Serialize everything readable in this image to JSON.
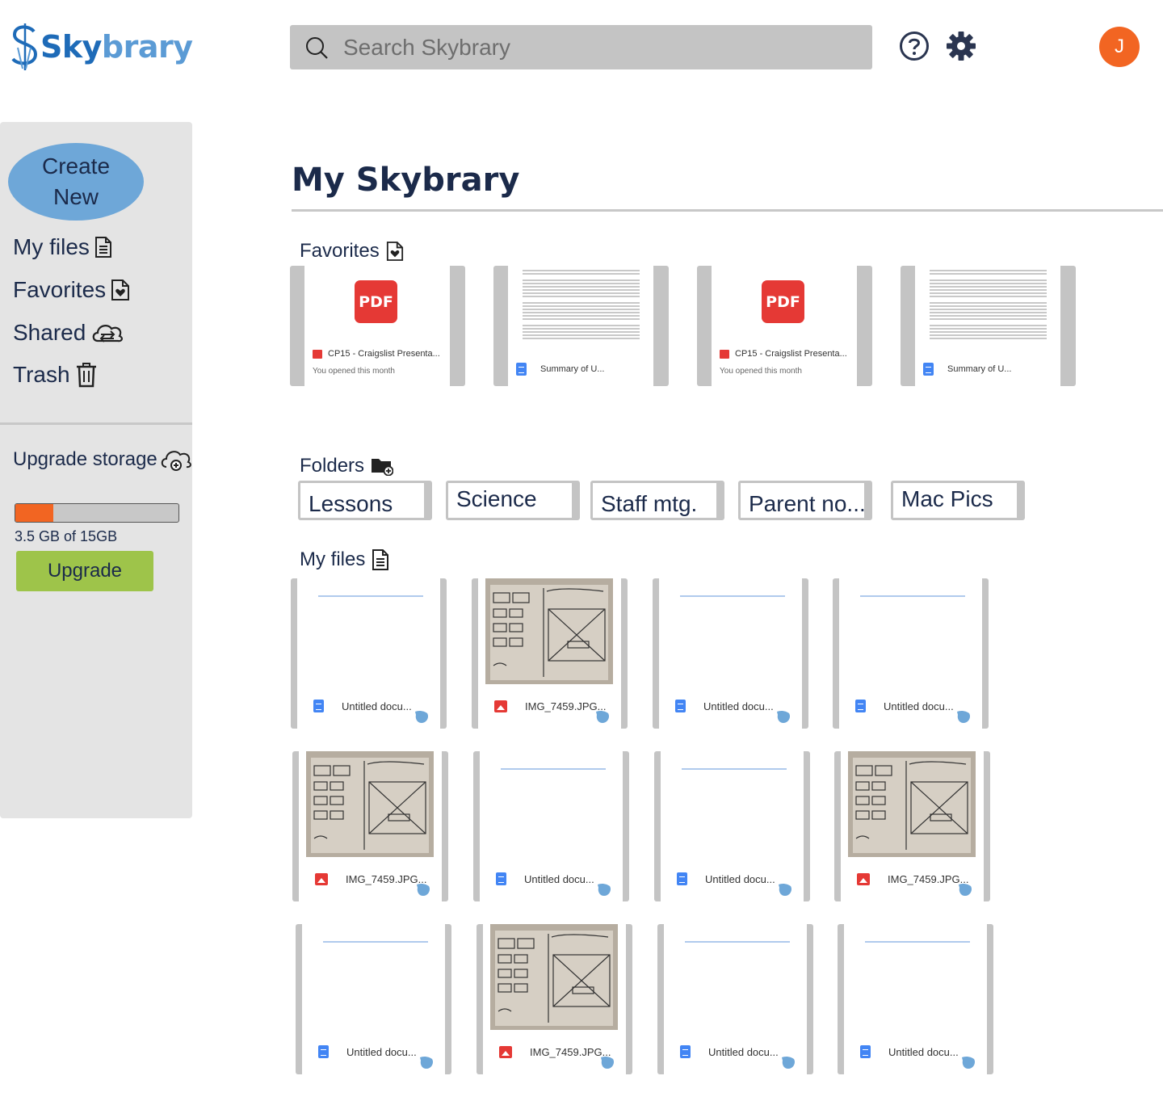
{
  "app": {
    "logo_sky": "Sky",
    "logo_brary": "brary",
    "logo_mark": "$"
  },
  "header": {
    "search_placeholder": "Search Skybrary",
    "avatar_initial": "J",
    "icons": [
      "help-icon",
      "gear-icon"
    ]
  },
  "sidebar": {
    "create_line1": "Create",
    "create_line2": "New",
    "items": [
      {
        "label": "My files",
        "icon": "document-icon"
      },
      {
        "label": "Favorites",
        "icon": "favorite-file-icon"
      },
      {
        "label": "Shared",
        "icon": "cloud-share-icon"
      },
      {
        "label": "Trash",
        "icon": "trash-icon"
      }
    ],
    "upgrade_storage_label": "Upgrade storage",
    "storage_used_fraction": 0.233,
    "storage_text": "3.5 GB of 15GB",
    "upgrade_button": "Upgrade",
    "colors": {
      "storage_fill": "#f26522",
      "upgrade_button": "#9ec44a",
      "create_button": "#6ea7d8"
    }
  },
  "main": {
    "title": "My Skybrary",
    "favorites_label": "Favorites",
    "favorites": [
      {
        "type": "pdf",
        "badge": "PDF",
        "name": "CP15 - Craigslist Presenta...",
        "sub": "You opened this month"
      },
      {
        "type": "doc",
        "name": "Summary of U..."
      },
      {
        "type": "pdf",
        "badge": "PDF",
        "name": "CP15 - Craigslist Presenta...",
        "sub": "You opened this month"
      },
      {
        "type": "doc",
        "name": "Summary of U..."
      }
    ],
    "folders_label": "Folders",
    "folders": [
      "Lessons",
      "Science",
      "Staff mtg.",
      "Parent no...",
      "Mac Pics"
    ],
    "myfiles_label": "My files",
    "files": [
      {
        "type": "doc",
        "name": "Untitled docu..."
      },
      {
        "type": "img",
        "name": "IMG_7459.JPG..."
      },
      {
        "type": "doc",
        "name": "Untitled docu..."
      },
      {
        "type": "doc",
        "name": "Untitled docu..."
      },
      {
        "type": "img",
        "name": "IMG_7459.JPG..."
      },
      {
        "type": "doc",
        "name": "Untitled docu..."
      },
      {
        "type": "doc",
        "name": "Untitled docu..."
      },
      {
        "type": "img",
        "name": "IMG_7459.JPG..."
      },
      {
        "type": "doc",
        "name": "Untitled docu..."
      },
      {
        "type": "img",
        "name": "IMG_7459.JPG..."
      },
      {
        "type": "doc",
        "name": "Untitled docu..."
      },
      {
        "type": "doc",
        "name": "Untitled docu..."
      }
    ]
  }
}
